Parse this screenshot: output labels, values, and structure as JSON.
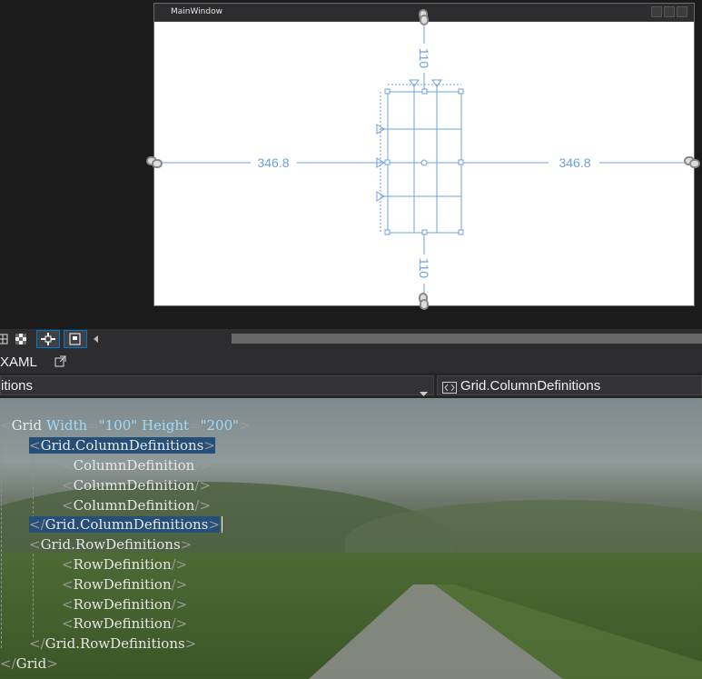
{
  "window": {
    "title": "MainWindow"
  },
  "designer": {
    "top_margin": "110",
    "bottom_margin": "110",
    "left_margin": "346.8",
    "right_margin": "346.8"
  },
  "tabs": {
    "xaml_label": "XAML"
  },
  "nav": {
    "left_combo": "itions",
    "right_combo": "Grid.ColumnDefinitions"
  },
  "code": {
    "line1": {
      "tag": "Grid",
      "attr1": "Width",
      "val1": "\"100\"",
      "attr2": "Height",
      "val2": "\"200\""
    },
    "line2": {
      "tag": "Grid.ColumnDefinitions"
    },
    "line3": {
      "tag": "ColumnDefinition"
    },
    "line4": {
      "tag": "ColumnDefinition"
    },
    "line5": {
      "tag": "ColumnDefinition"
    },
    "line6": {
      "tag": "Grid.ColumnDefinitions"
    },
    "line7": {
      "tag": "Grid.RowDefinitions"
    },
    "line8": {
      "tag": "RowDefinition"
    },
    "line9": {
      "tag": "RowDefinition"
    },
    "line10": {
      "tag": "RowDefinition"
    },
    "line11": {
      "tag": "RowDefinition"
    },
    "line12": {
      "tag": "Grid.RowDefinitions"
    },
    "line13": {
      "tag": "Grid"
    }
  },
  "icons": [
    "grid-icon",
    "checkerboard-icon",
    "snap-icon",
    "artboard-icon",
    "scroll-left-icon",
    "popout-icon",
    "dropdown-arrow-icon",
    "code-bracket-icon",
    "chain-link-icon",
    "triangle-marker-icon"
  ],
  "colors": {
    "accent": "#6f9fe0",
    "selection": "#264f78",
    "background": "#1b1b1c"
  }
}
